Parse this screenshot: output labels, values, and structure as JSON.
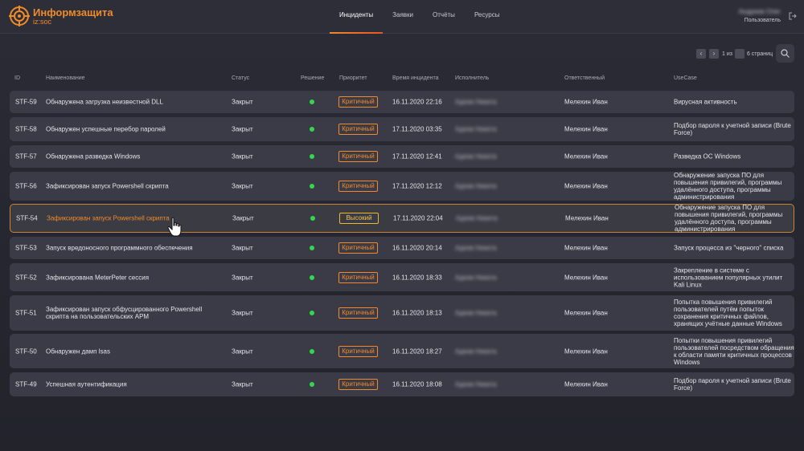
{
  "app": {
    "logo_title": "Информзащита",
    "logo_sub": "iz:soc",
    "accent": "#f08a2a"
  },
  "nav": [
    {
      "label": "Инциденты",
      "active": true
    },
    {
      "label": "Заявки",
      "active": false
    },
    {
      "label": "Отчёты",
      "active": false
    },
    {
      "label": "Ресурсы",
      "active": false
    }
  ],
  "user": {
    "name": "Андреев Олег",
    "role": "Пользователь"
  },
  "pager": {
    "prev": "‹",
    "next": "›",
    "of": "1 из",
    "pages": "6 страниц"
  },
  "columns": {
    "id": "ID",
    "name": "Наименование",
    "status": "Статус",
    "decision": "Решение",
    "priority": "Приоритет",
    "time": "Время инцидента",
    "executor": "Исполнитель",
    "responsible": "Ответственный",
    "usecase": "UseCase"
  },
  "rows": [
    {
      "id": "STF-59",
      "name": "Обнаружена загрузка неизвестной DLL",
      "status": "Закрыт",
      "priority": "Критичный",
      "time": "16.11.2020 22:16",
      "executor": "Адеев Никита",
      "responsible": "Мелехин Иван",
      "usecase": "Вирусная активность"
    },
    {
      "id": "STF-58",
      "name": "Обнаружен успешные перебор паролей",
      "status": "Закрыт",
      "priority": "Критичный",
      "time": "17.11.2020 03:35",
      "executor": "Адеев Никита",
      "responsible": "Мелехин Иван",
      "usecase": "Подбор пароля к учетной записи (Brute Force)"
    },
    {
      "id": "STF-57",
      "name": "Обнаружена разведка Windows",
      "status": "Закрыт",
      "priority": "Критичный",
      "time": "17.11.2020 12:41",
      "executor": "Адеев Никита",
      "responsible": "Мелехин Иван",
      "usecase": "Разведка ОС Windows"
    },
    {
      "id": "STF-56",
      "name": "Зафиксирован запуск Powershell скрипта",
      "status": "Закрыт",
      "priority": "Критичный",
      "time": "17.11.2020 12:12",
      "executor": "Адеев Никита",
      "responsible": "Мелехин Иван",
      "usecase": "Обнаружение запуска ПО для повышения привилегий, программы удалённого доступа, программы администрирования"
    },
    {
      "id": "STF-54",
      "name": "Зафиксирован запуск Powershell скрипта",
      "status": "Закрыт",
      "priority": "Высокий",
      "time": "17.11.2020 22:04",
      "executor": "Адеев Никита",
      "responsible": "Мелехин Иван",
      "usecase": "Обнаружение запуска ПО для повышения привилегий, программы удалённого доступа, программы администрирования"
    },
    {
      "id": "STF-53",
      "name": "Запуск вредоносного программного обеспечения",
      "status": "Закрыт",
      "priority": "Критичный",
      "time": "16.11.2020 20:14",
      "executor": "Адеев Никита",
      "responsible": "Мелехин Иван",
      "usecase": "Запуск процесса из \"черного\" списка"
    },
    {
      "id": "STF-52",
      "name": "Зафиксирована MeterPeter сессия",
      "status": "Закрыт",
      "priority": "Критичный",
      "time": "16.11.2020 18:33",
      "executor": "Адеев Никита",
      "responsible": "Мелехин Иван",
      "usecase": "Закрепление в системе с использованием популярных утилит Kali Linux"
    },
    {
      "id": "STF-51",
      "name": "Зафиксирован запуск обфусцированного Powershell скрипта на пользовательских АРМ",
      "status": "Закрыт",
      "priority": "Критичный",
      "time": "16.11.2020 18:13",
      "executor": "Адеев Никита",
      "responsible": "Мелехин Иван",
      "usecase": "Попытка повышения привилегий пользователей путём попыток сохранения критичных файлов, хранящих учётные данные Windows"
    },
    {
      "id": "STF-50",
      "name": "Обнаружен дамп lsas",
      "status": "Закрыт",
      "priority": "Критичный",
      "time": "16.11.2020 18:27",
      "executor": "Адеев Никита",
      "responsible": "Мелехин Иван",
      "usecase": "Попытки повышения привилегий пользователей посредством обращения к области памяти критичных процессов Windows"
    },
    {
      "id": "STF-49",
      "name": "Успешная аутентификация",
      "status": "Закрыт",
      "priority": "Критичный",
      "time": "16.11.2020 18:08",
      "executor": "Адеев Никита",
      "responsible": "Мелехин Иван",
      "usecase": "Подбор пароля к учетной записи (Brute Force)"
    }
  ]
}
